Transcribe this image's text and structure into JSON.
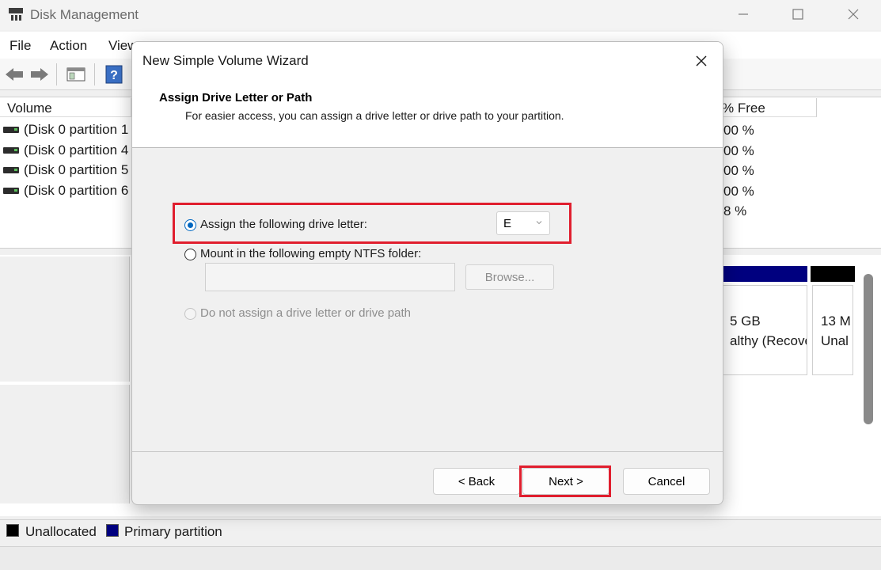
{
  "window": {
    "title": "Disk Management",
    "menu": [
      "File",
      "Action",
      "View",
      "Help"
    ]
  },
  "volume_list": {
    "col_volume": "Volume",
    "col_free": "% Free",
    "rows": [
      {
        "name": "(Disk 0 partition 1",
        "free": "00 %"
      },
      {
        "name": "(Disk 0 partition 4",
        "free": "00 %"
      },
      {
        "name": "(Disk 0 partition 5",
        "free": "00 %"
      },
      {
        "name": "(Disk 0 partition 6",
        "free": "00 %"
      },
      {
        "name": "",
        "free": "8 %"
      }
    ]
  },
  "disk_map": {
    "recovery": {
      "size": "5 GB",
      "status": "althy (Recove"
    },
    "unallocated": {
      "size": "13 M",
      "status": "Unal"
    }
  },
  "legend": {
    "unallocated": "Unallocated",
    "primary": "Primary partition",
    "unallocated_color": "#000000",
    "primary_color": "#00007f"
  },
  "wizard": {
    "title": "New Simple Volume Wizard",
    "heading": "Assign Drive Letter or Path",
    "subheading": "For easier access, you can assign a drive letter or drive path to your partition.",
    "options": {
      "assign_letter": "Assign the following drive letter:",
      "mount_folder": "Mount in the following empty NTFS folder:",
      "no_assign": "Do not assign a drive letter or drive path"
    },
    "selected_option": "assign_letter",
    "drive_letter": "E",
    "folder_path": "",
    "browse_label": "Browse...",
    "back_label": "< Back",
    "next_label": "Next >",
    "cancel_label": "Cancel",
    "highlight_color": "#e01e2e",
    "accent_color": "#0067c0"
  }
}
